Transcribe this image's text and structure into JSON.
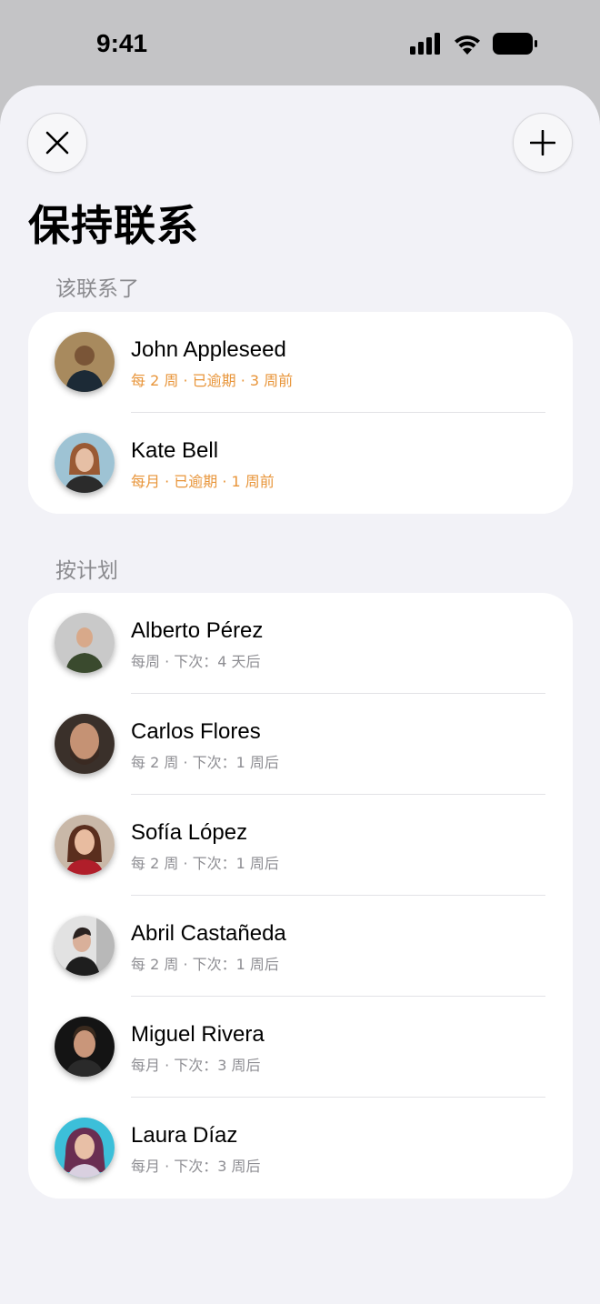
{
  "status_bar": {
    "time": "9:41"
  },
  "title": "保持联系",
  "sections": [
    {
      "header": "该联系了",
      "contacts": [
        {
          "name": "John Appleseed",
          "detail": "每 2 周 · 已逾期 · 3 周前",
          "avatar_color": "#6b5a45"
        },
        {
          "name": "Kate Bell",
          "detail": "每月 · 已逾期 · 1 周前",
          "avatar_color": "#8fb6c9"
        }
      ]
    },
    {
      "header": "按计划",
      "contacts": [
        {
          "name": "Alberto Pérez",
          "detail": "每周 · 下次：4 天后",
          "avatar_color": "#bfbfbf"
        },
        {
          "name": "Carlos Flores",
          "detail": "每 2 周 · 下次：1 周后",
          "avatar_color": "#4b3a30"
        },
        {
          "name": "Sofía López",
          "detail": "每 2 周 · 下次：1 周后",
          "avatar_color": "#9a4a3a"
        },
        {
          "name": "Abril Castañeda",
          "detail": "每 2 周 · 下次：1 周后",
          "avatar_color": "#d9d9d9"
        },
        {
          "name": "Miguel Rivera",
          "detail": "每月 · 下次：3 周后",
          "avatar_color": "#1c1c1c"
        },
        {
          "name": "Laura Díaz",
          "detail": "每月 · 下次：3 周后",
          "avatar_color": "#7a4a5c"
        }
      ]
    }
  ],
  "colors": {
    "overdue": "#e8953a",
    "secondary": "#8e8e93",
    "background": "#f2f2f7"
  },
  "icons": [
    "close-icon",
    "plus-icon",
    "signal-icon",
    "wifi-icon",
    "battery-icon"
  ]
}
